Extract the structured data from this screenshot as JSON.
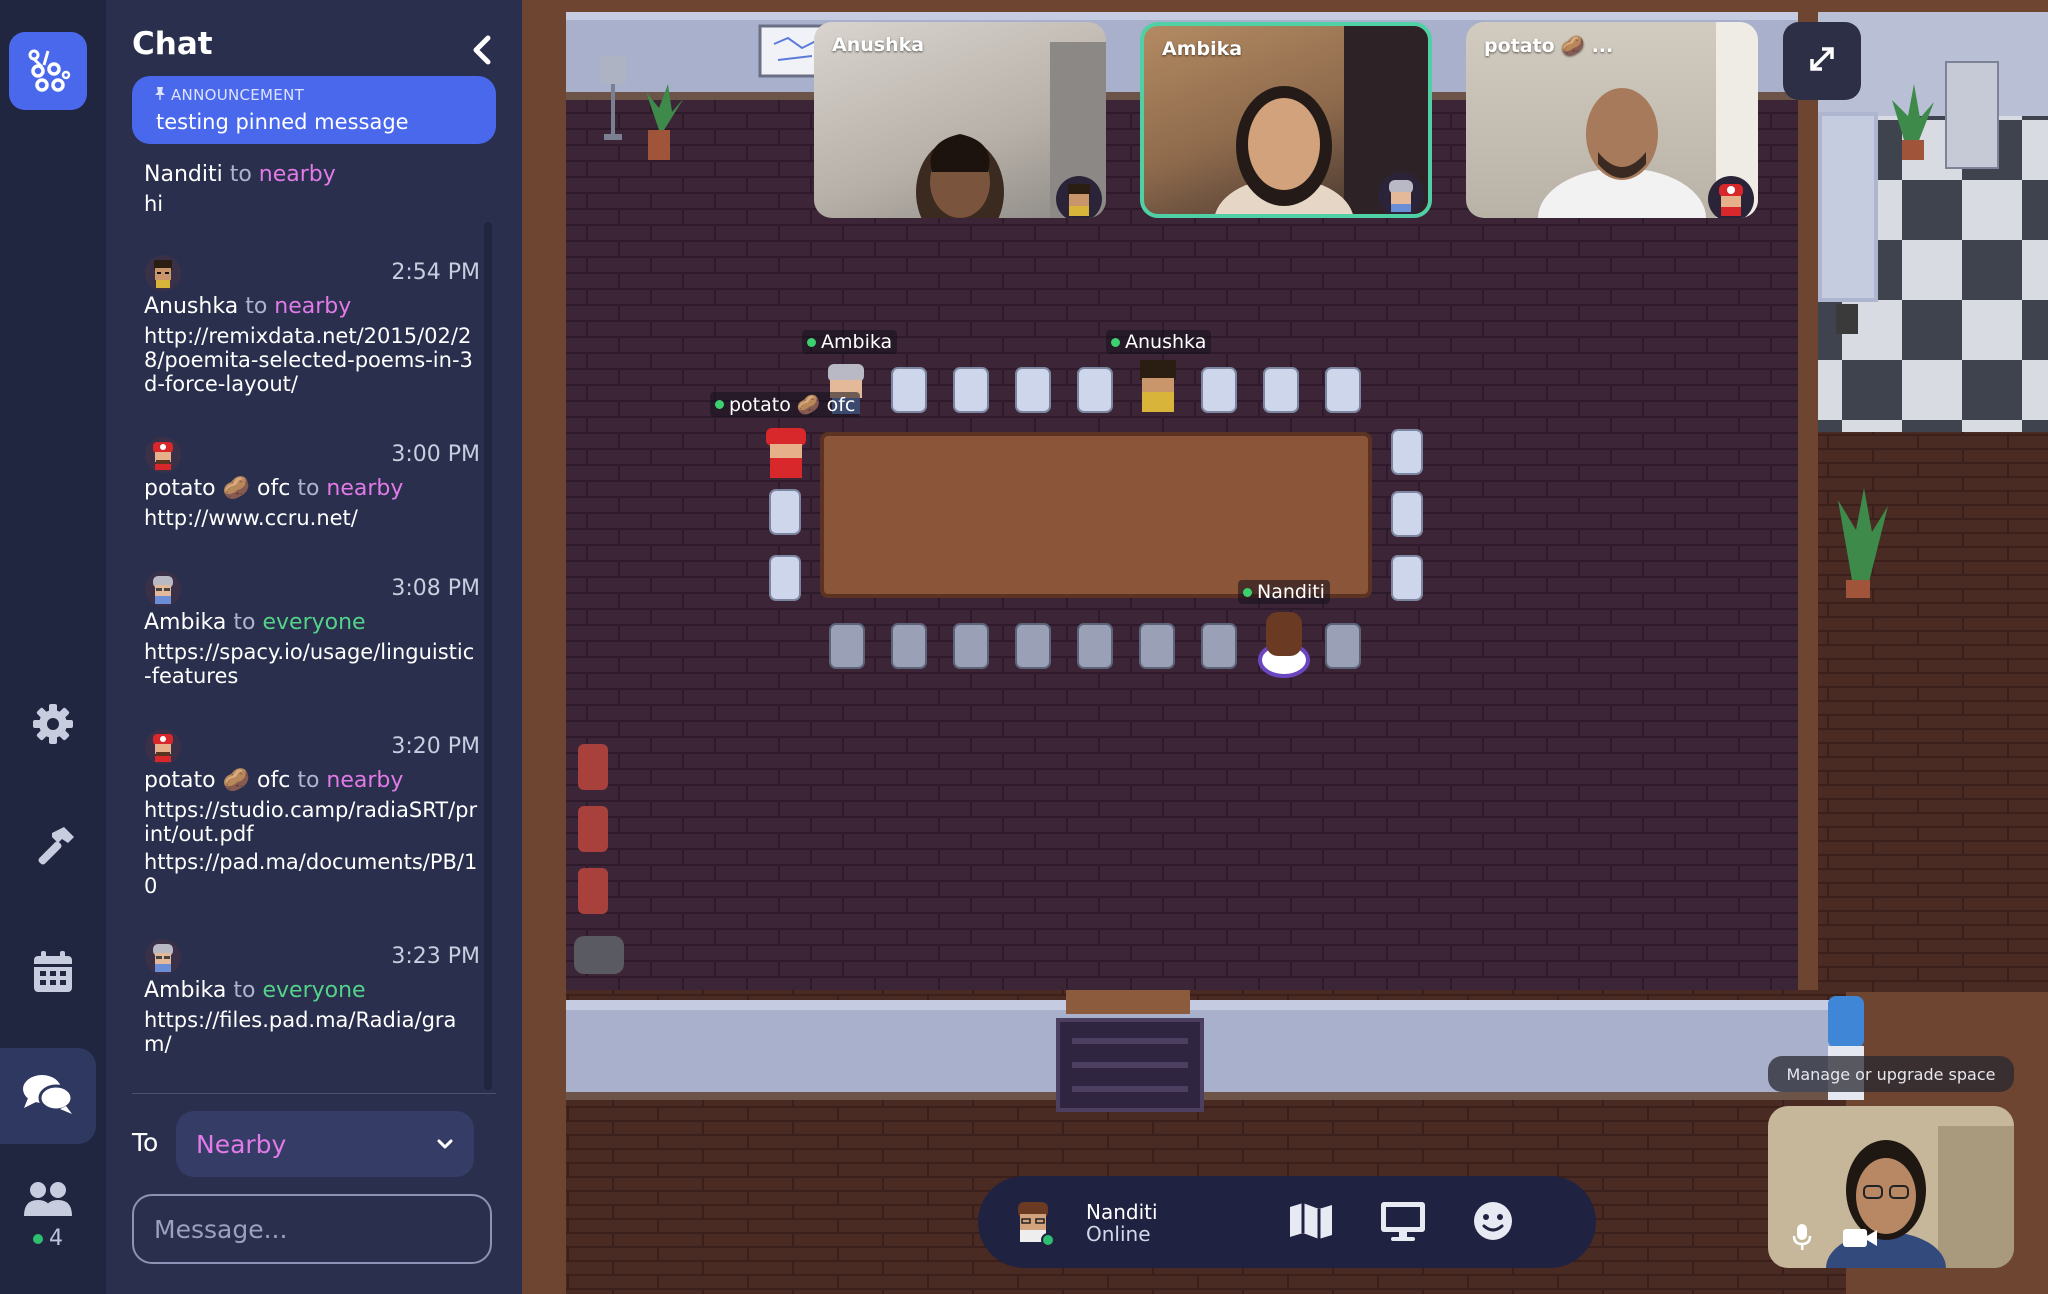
{
  "rail": {
    "participant_count": "4"
  },
  "chat": {
    "title": "Chat",
    "announcement": {
      "label": "ANNOUNCEMENT",
      "text": "testing pinned message"
    },
    "messages": [
      {
        "sender": "Nanditi",
        "to_word": "to",
        "target": "nearby",
        "time": "",
        "body": [
          "hi"
        ]
      },
      {
        "sender": "Anushka",
        "to_word": "to",
        "target": "nearby",
        "time": "2:54 PM",
        "body": [
          "http://remixdata.net/2015/02/28/poemita-selected-poems-in-3d-force-layout/"
        ]
      },
      {
        "sender": "potato 🥔 ofc",
        "to_word": "to",
        "target": "nearby",
        "time": "3:00 PM",
        "body": [
          "http://www.ccru.net/"
        ]
      },
      {
        "sender": "Ambika",
        "to_word": "to",
        "target": "everyone",
        "time": "3:08 PM",
        "body": [
          "https://spacy.io/usage/linguistic-features"
        ]
      },
      {
        "sender": "potato 🥔 ofc",
        "to_word": "to",
        "target": "nearby",
        "time": "3:20 PM",
        "body": [
          "https://studio.camp/radiaSRT/print/out.pdf",
          "https://pad.ma/documents/PB/10"
        ]
      },
      {
        "sender": "Ambika",
        "to_word": "to",
        "target": "everyone",
        "time": "3:23 PM",
        "body": [
          "https://files.pad.ma/Radia/gram/"
        ]
      }
    ],
    "to_label": "To",
    "to_value": "Nearby",
    "message_placeholder": "Message..."
  },
  "game": {
    "videos": [
      {
        "name": "Anushka"
      },
      {
        "name": "Ambika"
      },
      {
        "name": "potato 🥔 ..."
      }
    ],
    "players": {
      "ambika": "Ambika",
      "anushka": "Anushka",
      "potato": "potato 🥔 ofc",
      "nanditi": "Nanditi"
    },
    "manage_label": "Manage or upgrade space",
    "bottom_bar": {
      "name": "Nanditi",
      "status": "Online"
    }
  },
  "colors": {
    "rail_bg": "#202540",
    "chat_bg": "#292f4c",
    "accent": "#4a68ec",
    "nearby": "#e27ae7",
    "everyone": "#54d28a",
    "online": "#2fbf71"
  },
  "icons": [
    "gather-logo-icon",
    "chevron-left-icon",
    "pin-icon",
    "gear-icon",
    "hammer-icon",
    "calendar-icon",
    "chat-bubbles-icon",
    "people-icon",
    "chevron-down-icon",
    "expand-icon",
    "map-icon",
    "screen-share-icon",
    "emoji-icon",
    "mic-icon",
    "camera-icon"
  ]
}
